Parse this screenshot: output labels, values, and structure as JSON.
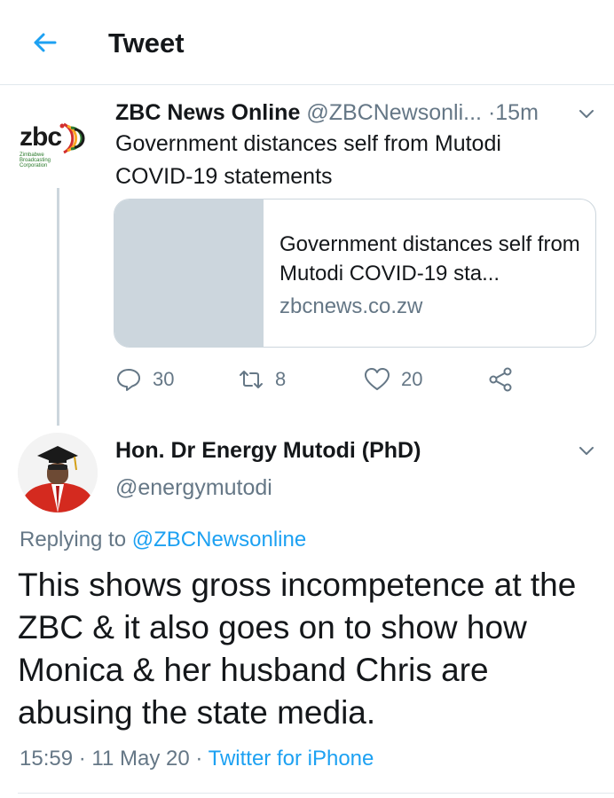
{
  "header": {
    "title": "Tweet",
    "back_icon": "arrow-left-icon"
  },
  "colors": {
    "accent": "#1da1f2",
    "muted": "#657786",
    "text": "#14171a",
    "border": "#ccd6dd"
  },
  "quoted_tweet": {
    "logo_text": "zbc",
    "logo_sub": "Zimbabwe Broadcasting Corporation",
    "name": "ZBC News Online",
    "handle": "@ZBCNewsonli...",
    "separator": "·",
    "time": "15m",
    "text": "Government distances self from Mutodi COVID-19 statements",
    "card": {
      "title": "Government distances self from Mutodi COVID-19 sta...",
      "domain": "zbcnews.co.zw"
    },
    "actions": {
      "replies": "30",
      "retweets": "8",
      "likes": "20"
    }
  },
  "main_tweet": {
    "name": "Hon. Dr Energy Mutodi (PhD)",
    "handle": "@energymutodi",
    "replying_label": "Replying to",
    "replying_to": "@ZBCNewsonline",
    "text": "This shows gross incompetence at the ZBC & it also goes on to show how Monica & her husband Chris are abusing the state media.",
    "time": "15:59",
    "date": "11 May 20",
    "meta_sep": "·",
    "source": "Twitter for iPhone"
  }
}
